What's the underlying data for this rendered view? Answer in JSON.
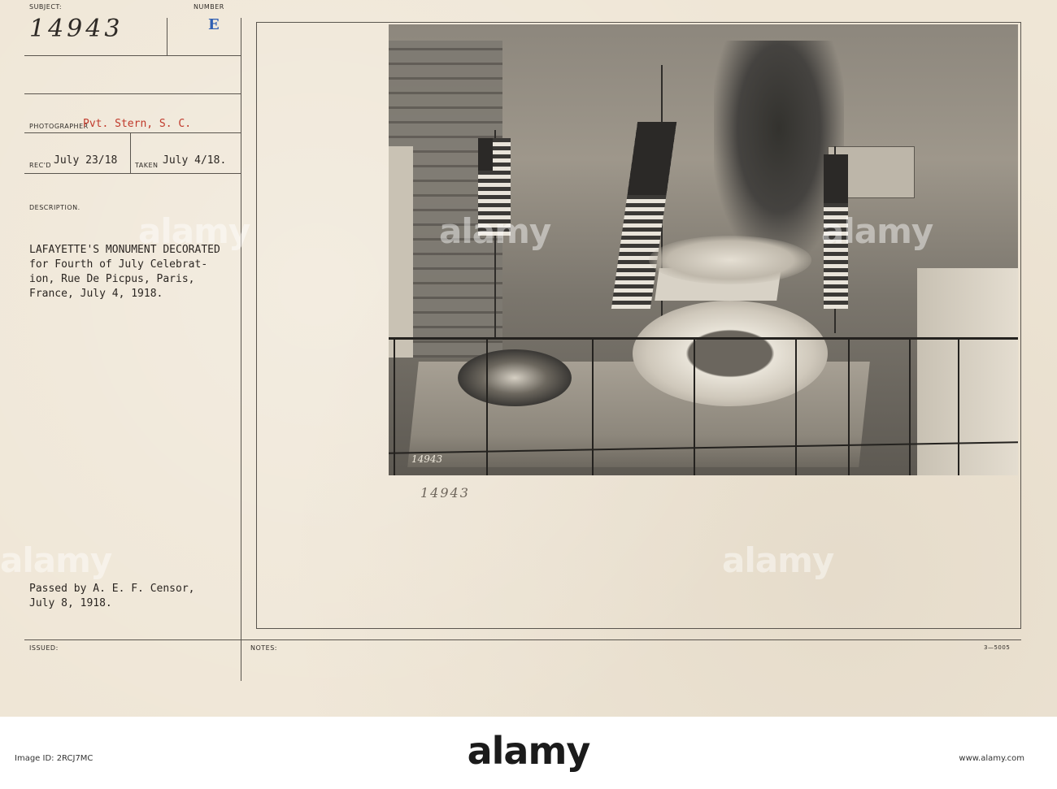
{
  "card": {
    "subject_label": "SUBJECT:",
    "subject_value": "14943",
    "number_label": "NUMBER",
    "number_value": "E",
    "photographer_label": "PHOTOGRAPHER",
    "photographer_value": "Pvt. Stern, S. C.",
    "recd_label": "REC'D",
    "recd_value": "July 23/18",
    "taken_label": "TAKEN",
    "taken_value": "July 4/18.",
    "description_label": "DESCRIPTION.",
    "description_lines": [
      "LAFAYETTE'S MONUMENT DECORATED",
      "for Fourth of July Celebrat-",
      "ion, Rue De Picpus, Paris,",
      "France, July 4, 1918."
    ],
    "censor_lines": [
      "Passed by A. E. F. Censor,",
      "July 8, 1918."
    ],
    "issued_label": "ISSUED:",
    "notes_label": "NOTES:",
    "form_code": "3—5005",
    "photo_number_in_image": "14943",
    "handwritten_number": "14943"
  },
  "watermark": {
    "logo_text": "alamy",
    "image_id": "Image ID: 2RCJ7MC",
    "site": "www.alamy.com"
  },
  "colors": {
    "card_bg": "#efe6d6",
    "stamp_red": "#c0392b",
    "stamp_blue": "#2f5fb3"
  }
}
